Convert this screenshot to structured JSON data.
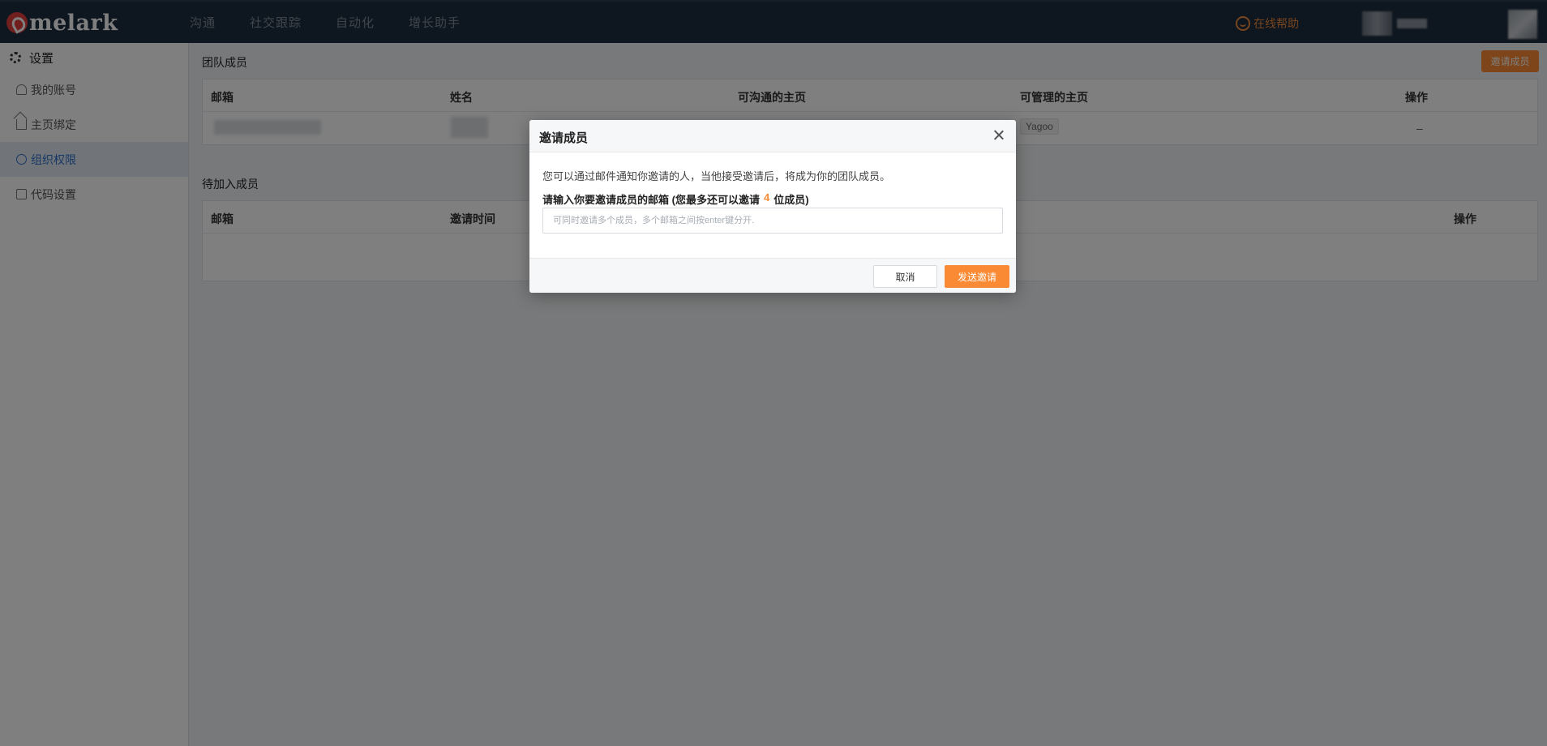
{
  "app": {
    "logo_text": "melark"
  },
  "nav": {
    "items": [
      "沟通",
      "社交跟踪",
      "自动化",
      "增长助手"
    ]
  },
  "header": {
    "help_label": "在线帮助"
  },
  "sidebar": {
    "title": "设置",
    "items": [
      {
        "label": "我的账号",
        "icon": "user-icon"
      },
      {
        "label": "主页绑定",
        "icon": "home-icon"
      },
      {
        "label": "组织权限",
        "icon": "org-icon",
        "active": true
      },
      {
        "label": "代码设置",
        "icon": "code-icon"
      }
    ]
  },
  "team": {
    "title": "团队成员",
    "invite_button": "邀请成员",
    "columns": [
      "邮箱",
      "姓名",
      "可沟通的主页",
      "可管理的主页",
      "操作"
    ],
    "rows": [
      {
        "manageable_page_tag": "Yagoo",
        "action": "–"
      }
    ]
  },
  "pending": {
    "title": "待加入成员",
    "columns": [
      "邮箱",
      "邀请时间",
      "操作"
    ]
  },
  "modal": {
    "title": "邀请成员",
    "description": "您可以通过邮件通知你邀请的人，当他接受邀请后，将成为你的团队成员。",
    "prompt_before": "请输入你要邀请成员的邮箱 (您最多还可以邀请",
    "prompt_count": "4",
    "prompt_after": "位成员)",
    "input_value": "",
    "input_placeholder": "可同时邀请多个成员，多个邮箱之间按enter键分开.",
    "cancel_label": "取消",
    "send_label": "发送邀请"
  },
  "colors": {
    "accent": "#fa8a33",
    "topbar": "#1d2d3e",
    "active_blue": "#2f6fc8"
  }
}
